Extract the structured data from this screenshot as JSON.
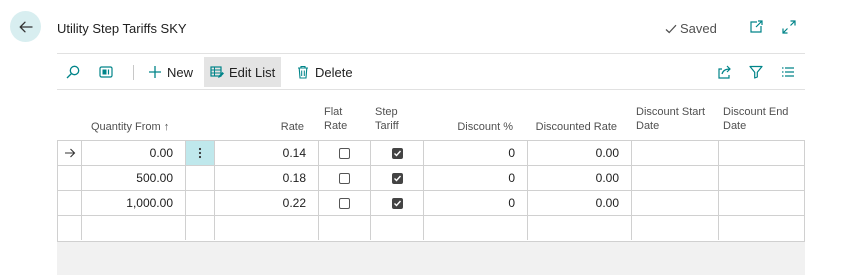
{
  "header": {
    "title": "Utility Step Tariffs SKY",
    "saved_label": "Saved"
  },
  "toolbar": {
    "new_label": "New",
    "edit_list_label": "Edit List",
    "delete_label": "Delete"
  },
  "columns": {
    "quantity_from": "Quantity From ↑",
    "rate": "Rate",
    "flat_rate_1": "Flat",
    "flat_rate_2": "Rate",
    "step_tariff_1": "Step",
    "step_tariff_2": "Tariff",
    "discount_pct": "Discount %",
    "discounted_rate": "Discounted Rate",
    "discount_start_1": "Discount Start",
    "discount_start_2": "Date",
    "discount_end_1": "Discount End",
    "discount_end_2": "Date"
  },
  "rows": [
    {
      "quantity_from": "0.00",
      "rate": "0.14",
      "flat_rate": false,
      "step_tariff": true,
      "discount_pct": "0",
      "discounted_rate": "0.00",
      "discount_start": "",
      "discount_end": ""
    },
    {
      "quantity_from": "500.00",
      "rate": "0.18",
      "flat_rate": false,
      "step_tariff": true,
      "discount_pct": "0",
      "discounted_rate": "0.00",
      "discount_start": "",
      "discount_end": ""
    },
    {
      "quantity_from": "1,000.00",
      "rate": "0.22",
      "flat_rate": false,
      "step_tariff": true,
      "discount_pct": "0",
      "discounted_rate": "0.00",
      "discount_start": "",
      "discount_end": ""
    }
  ],
  "icons": {
    "back": "arrow-left-icon",
    "saved": "checkmark-icon",
    "open_new": "open-in-new-window-icon",
    "expand": "expand-icon",
    "search": "search-icon",
    "layout": "layout-icon",
    "new": "plus-icon",
    "edit_list": "edit-list-icon",
    "delete": "trash-icon",
    "share": "share-icon",
    "filter": "filter-icon",
    "list_view": "list-view-icon",
    "row_pointer": "row-pointer-arrow-icon",
    "row_menu": "more-vertical-icon"
  },
  "colors": {
    "accent": "#008489",
    "back_button_bg": "#d8eef0",
    "menu_cell_bg": "#bfe8ec"
  }
}
